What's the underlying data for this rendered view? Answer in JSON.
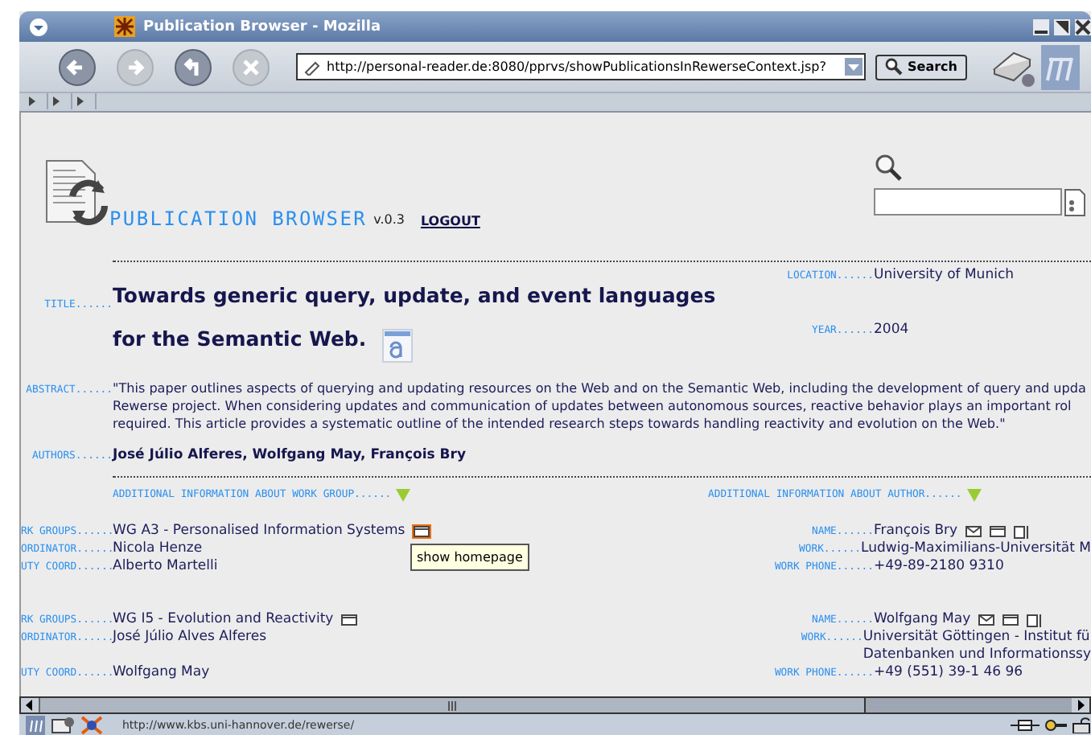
{
  "window": {
    "title": "Publication Browser - Mozilla"
  },
  "toolbar": {
    "buttons": [
      {
        "kind": "back",
        "disabled": false
      },
      {
        "kind": "forward",
        "disabled": true
      },
      {
        "kind": "reload",
        "disabled": false
      },
      {
        "kind": "stop",
        "disabled": true
      }
    ],
    "url": "http://personal-reader.de:8080/pprvs/showPublicationsInRewerseContext.jsp?",
    "search_button": "Search"
  },
  "header": {
    "app_name": "PUBLICATION BROWSER",
    "version": "v.0.3",
    "logout": "LOGOUT"
  },
  "publication": {
    "title_label": "TITLE......",
    "title_lines": [
      "Towards generic query, update, and event languages",
      "for the Semantic Web."
    ],
    "location_label": "LOCATION......",
    "location": "University of Munich",
    "year_label": "YEAR......",
    "year": "2004",
    "abstract_label": "ABSTRACT......",
    "abstract_lines": [
      "\"This paper outlines aspects of querying and updating resources on the Web and on the Semantic Web, including the development of query and upda",
      "Rewerse project. When considering updates and communication of updates between autonomous sources, reactive behavior plays an important rol",
      "required. This article provides a systematic outline of the intended research steps towards handling reactivity and evolution on the Web.\""
    ],
    "authors_label": "AUTHORS......",
    "authors": "José Júlio Alferes, Wolfgang May, François Bry"
  },
  "additional": {
    "work_group_heading": "ADDITIONAL INFORMATION ABOUT WORK GROUP......",
    "author_heading": "ADDITIONAL INFORMATION ABOUT AUTHOR......"
  },
  "sections": [
    {
      "homepage_hovered": true,
      "rows": [
        {
          "left": {
            "label": "RK GROUPS......",
            "lines": [
              "WG A3 - Personalised Information Systems"
            ]
          },
          "right": {
            "label": "NAME......",
            "lines": [
              "François Bry"
            ]
          }
        },
        {
          "left": {
            "label": "ORDINATOR......",
            "lines": [
              "Nicola Henze"
            ]
          },
          "right": {
            "label": "WORK......",
            "lines": [
              "Ludwig-Maximilians-Universität M"
            ]
          }
        },
        {
          "left": {
            "label": "UTY COORD......",
            "lines": [
              "Alberto Martelli"
            ]
          },
          "right": {
            "label": "WORK PHONE......",
            "lines": [
              "+49-89-2180 9310"
            ]
          }
        }
      ]
    },
    {
      "homepage_hovered": false,
      "rows": [
        {
          "left": {
            "label": "RK GROUPS......",
            "lines": [
              "WG I5 - Evolution and Reactivity"
            ]
          },
          "right": {
            "label": "NAME......",
            "lines": [
              "Wolfgang May"
            ]
          }
        },
        {
          "left": {
            "label": "ORDINATOR......",
            "lines": [
              "José Júlio Alves Alferes"
            ]
          },
          "right": {
            "label": "WORK......",
            "lines": [
              "Universität Göttingen - Institut fü",
              "Datenbanken und Informationssy"
            ]
          }
        },
        {
          "left": {
            "label": "UTY COORD......",
            "lines": [
              "Wolfgang May"
            ]
          },
          "right": {
            "label": "WORK PHONE......",
            "lines": [
              "+49 (551) 39-1 46 96"
            ]
          }
        }
      ]
    }
  ],
  "tooltip": "show homepage",
  "status_bar": {
    "url": "http://www.kbs.uni-hannover.de/rewerse/"
  }
}
